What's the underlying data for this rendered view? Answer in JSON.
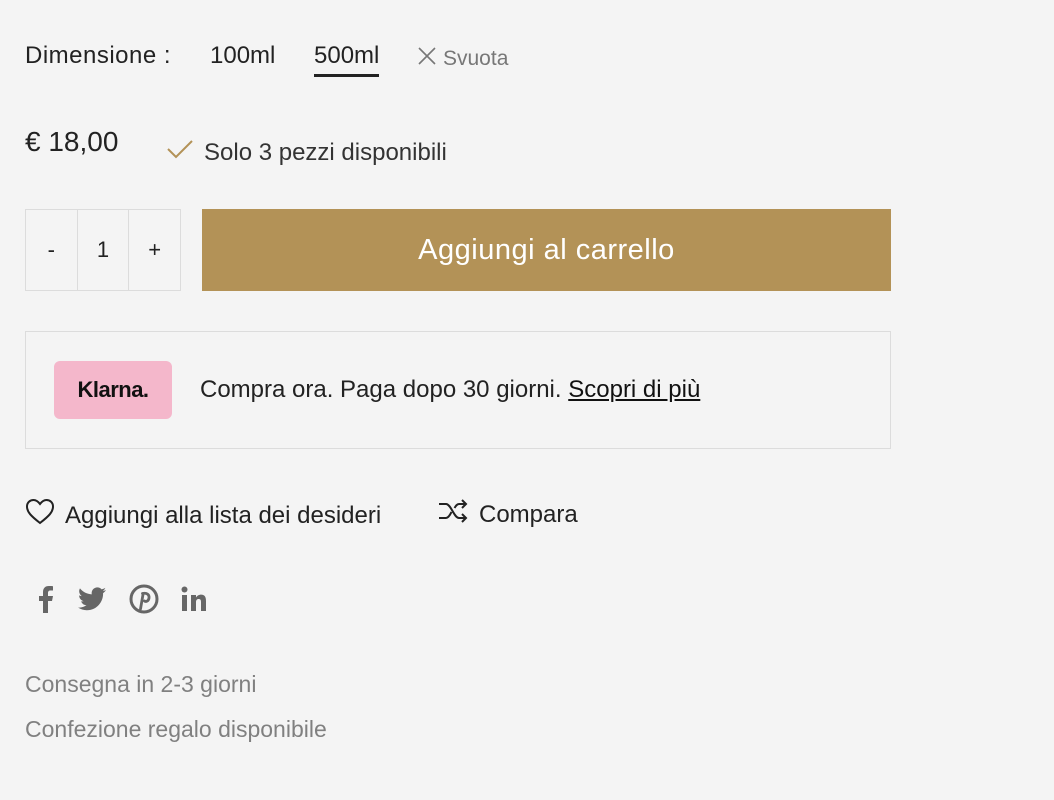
{
  "size": {
    "label": "Dimensione :",
    "options": [
      "100ml",
      "500ml"
    ],
    "selected": "500ml",
    "clear_label": "Svuota"
  },
  "price": "€ 18,00",
  "availability": "Solo 3 pezzi disponibili",
  "quantity": {
    "minus": "-",
    "value": "1",
    "plus": "+"
  },
  "add_to_cart": "Aggiungi al carrello",
  "klarna": {
    "logo_text": "Klarna.",
    "text": "Compra ora. Paga dopo 30 giorni.",
    "link": "Scopri di più"
  },
  "actions": {
    "wishlist": "Aggiungi alla lista dei desideri",
    "compare": "Compara"
  },
  "social_icons": [
    "facebook-icon",
    "twitter-icon",
    "pinterest-icon",
    "linkedin-icon"
  ],
  "info": [
    "Consegna in 2-3 giorni",
    "Confezione regalo disponibile"
  ],
  "colors": {
    "accent": "#b39257",
    "klarna_pink": "#f4b7cb",
    "background": "#f4f4f4"
  }
}
